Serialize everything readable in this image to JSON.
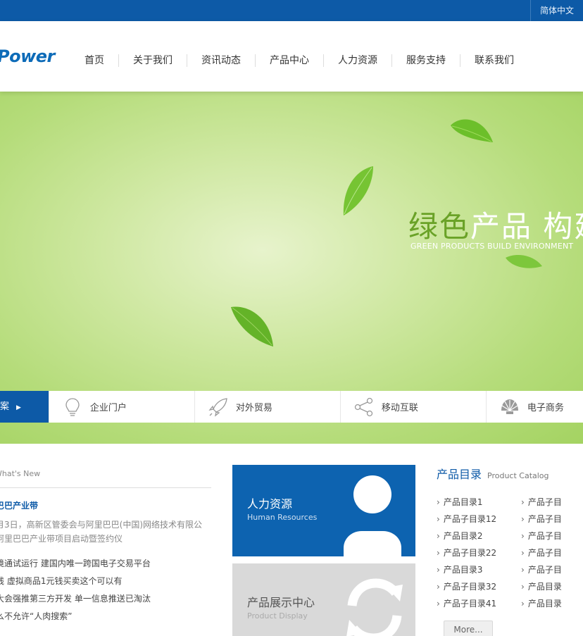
{
  "topbar": {
    "language": "简体中文"
  },
  "header": {
    "logo_text": "Power",
    "nav": [
      "首页",
      "关于我们",
      "资讯动态",
      "产品中心",
      "人力资源",
      "服务支持",
      "联系我们"
    ]
  },
  "banner": {
    "headline_green": "绿色",
    "headline_white": "产品  构建",
    "subtitle": "GREEN PRODUCTS BUILD ENVIRONMENT"
  },
  "strip": {
    "first_label": "案",
    "items": [
      {
        "label": "企业门户",
        "icon": "lightbulb-icon"
      },
      {
        "label": "对外贸易",
        "icon": "rocket-icon"
      },
      {
        "label": "移动互联",
        "icon": "share-icon"
      },
      {
        "label": "电子商务",
        "icon": "shell-icon"
      }
    ]
  },
  "news": {
    "section_title": "What's New",
    "headline": "巴巴产业带",
    "summary_line1": "月3日，高新区管委会与阿里巴巴(中国)网络技术有限公",
    "summary_line2": "阿里巴巴产业带项目启动暨签约仪",
    "items": [
      "境通试运行 建国内唯一跨国电子交易平台",
      "线 虚拟商品1元钱买卖这个可以有",
      "大会强推第三方开发 单一信息推送已淘汰",
      "么不允许“人肉搜索”"
    ]
  },
  "tiles": {
    "hr": {
      "title": "人力资源",
      "subtitle": "Human Resources",
      "icon": "person-icon"
    },
    "products": {
      "title": "产品展示中心",
      "subtitle": "Product Display",
      "icon": "refresh-icon"
    }
  },
  "catalog": {
    "title": "产品目录",
    "title_en": "Product Catalog",
    "col1": [
      "产品目录1",
      "产品子目录12",
      "产品目录2",
      "产品子目录22",
      "产品目录3",
      "产品子目录32",
      "产品子目录41"
    ],
    "col2": [
      "产品子目",
      "产品子目",
      "产品子目",
      "产品子目",
      "产品子目",
      "产品目录",
      "产品目录"
    ],
    "more_label": "More..."
  },
  "colors": {
    "brand_blue": "#0d5aa7",
    "banner_green": "#b5dc7a",
    "accent_green": "#6aa227"
  }
}
